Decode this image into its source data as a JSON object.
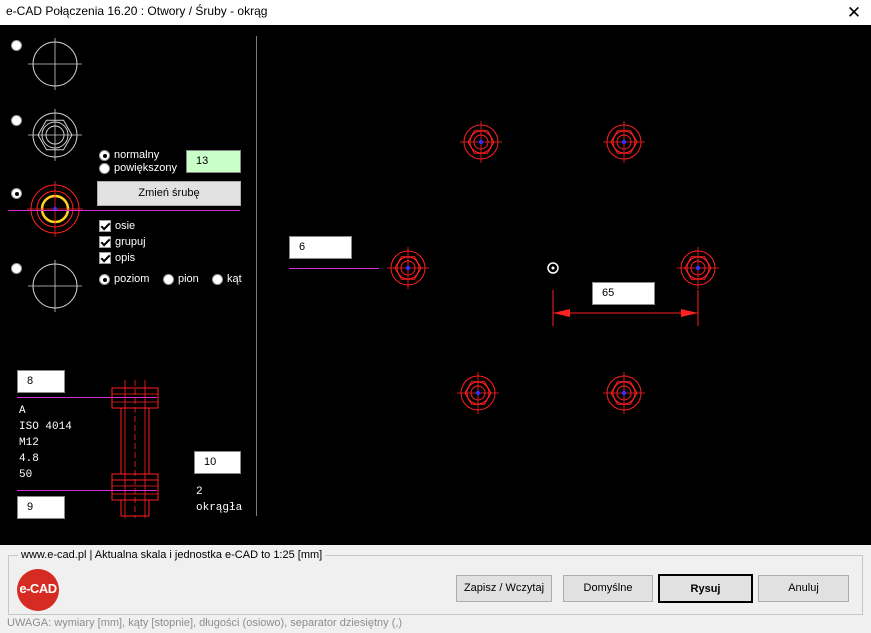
{
  "window": {
    "title": "e-CAD Połączenia 16.20 : Otwory / Śruby - okrąg",
    "close": "✕"
  },
  "hole_type": {
    "options": [
      "hole-plain",
      "hole-bolt-nut",
      "hole-highlighted",
      "hole-axes-only"
    ],
    "selected": 2
  },
  "hole_size": {
    "normal": "normalny",
    "enlarged": "powiększony",
    "selected": "normalny",
    "value": "13"
  },
  "change_bolt_button": "Zmień śrubę",
  "options": {
    "axes": "osie",
    "group": "grupuj",
    "description": "opis",
    "axes_checked": true,
    "group_checked": true,
    "description_checked": true
  },
  "orientation": {
    "horizontal": "poziom",
    "vertical": "pion",
    "angle": "kąt",
    "selected": "poziom"
  },
  "bolt": {
    "top_offset": "8",
    "spec_lines": [
      "A",
      "ISO 4014",
      "M12",
      "4.8",
      "50"
    ],
    "right_value": "10",
    "bottom_value": "9",
    "count": "2",
    "count_label": "okrągła"
  },
  "pattern": {
    "count_value": "6",
    "diameter_value": "65"
  },
  "colors": {
    "background": "#000000",
    "symbol_red": "#ff2020",
    "axis_magenta": "#d42ed4",
    "field_green": "#c9ffc9"
  },
  "footer": {
    "caption": "www.e-cad.pl | Aktualna skala i jednostka e-CAD to 1:25 [mm]",
    "logo": "e-CAD",
    "save_load": "Zapisz / Wczytaj",
    "defaults": "Domyślne",
    "draw": "Rysuj",
    "cancel": "Anuluj",
    "note": "UWAGA: wymiary [mm], kąty [stopnie], długości (osiowo), separator dziesiętny (,)"
  }
}
